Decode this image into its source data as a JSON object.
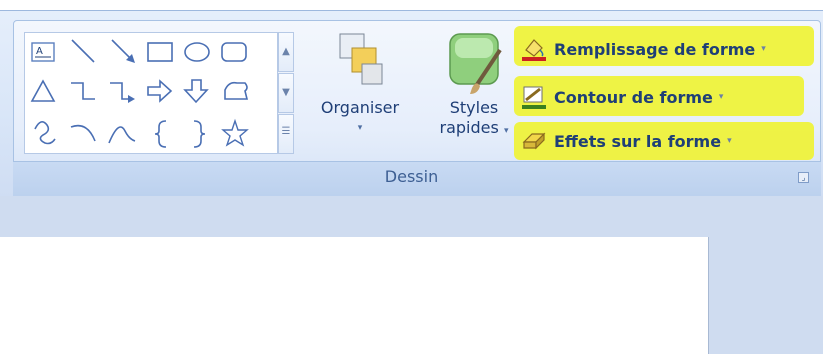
{
  "group": {
    "name": "Dessin",
    "launcher_label": "⌟"
  },
  "shapes_gallery": {
    "rows": [
      [
        "text-box",
        "line",
        "arrow-line",
        "rectangle",
        "oval",
        "rounded-rectangle"
      ],
      [
        "triangle",
        "elbow-connector",
        "elbow-arrow-connector",
        "right-arrow",
        "down-arrow",
        "callout-shape"
      ],
      [
        "freeform",
        "arc",
        "curve",
        "left-brace",
        "right-brace",
        "star"
      ]
    ]
  },
  "buttons": {
    "organiser": "Organiser",
    "styles_line1": "Styles",
    "styles_line2": "rapides",
    "dropdown_glyph": "▾"
  },
  "commands": [
    {
      "label": "Remplissage de forme",
      "icon": "fill-bucket-icon"
    },
    {
      "label": "Contour de forme",
      "icon": "pencil-outline-icon"
    },
    {
      "label": "Effets sur la forme",
      "icon": "shape-effects-icon"
    }
  ],
  "colors": {
    "highlight": "#eef23b",
    "ribbon_text": "#1f3f77",
    "group_label": "#3d5f93",
    "fill_underline": "#cc2222",
    "outline_underline": "#3a7f1e"
  }
}
